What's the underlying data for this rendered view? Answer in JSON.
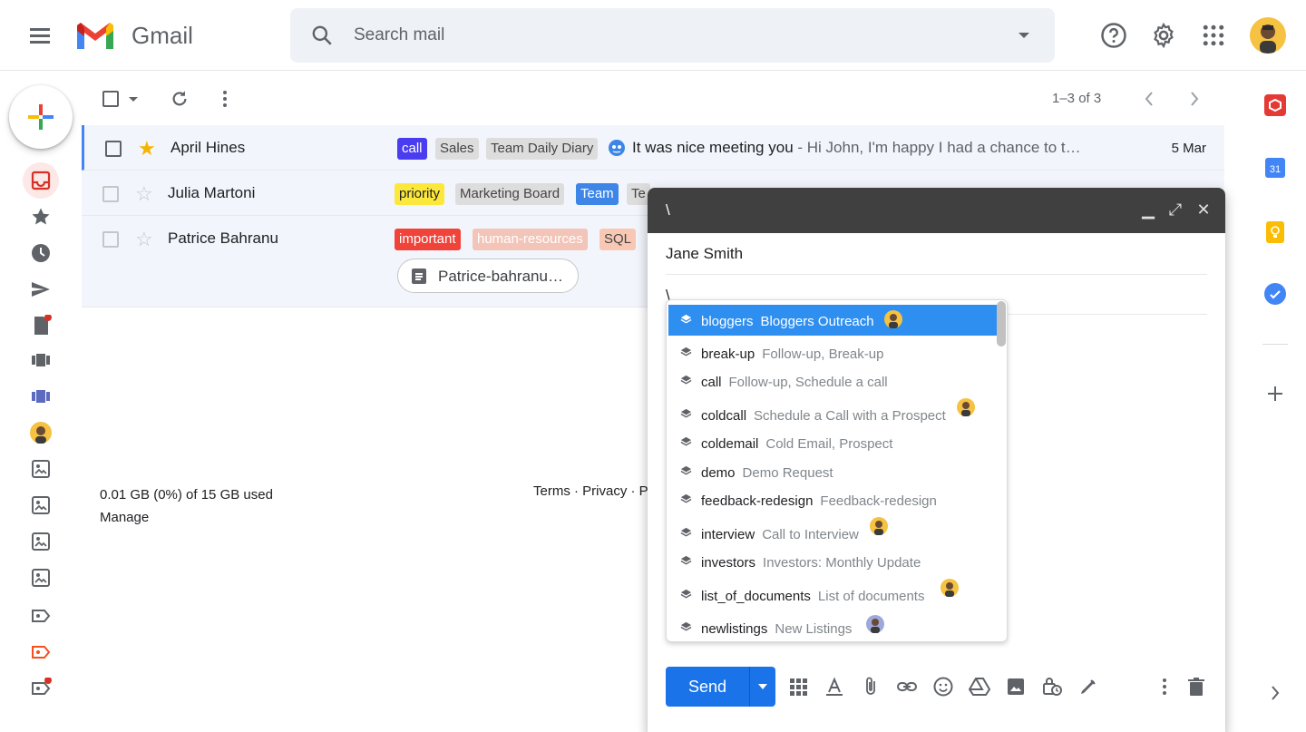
{
  "app": {
    "name": "Gmail"
  },
  "search": {
    "placeholder": "Search mail"
  },
  "toolbar": {
    "page_info": "1–3 of 3"
  },
  "emails": [
    {
      "sender": "April Hines",
      "starred": true,
      "labels": [
        {
          "text": "call",
          "bg": "#4a3df0",
          "fg": "#ffffff"
        },
        {
          "text": "Sales",
          "bg": "#dddddd",
          "fg": "#444444"
        },
        {
          "text": "Team Daily Diary",
          "bg": "#dddddd",
          "fg": "#444444"
        }
      ],
      "subject": "It was nice meeting you",
      "snippet": " - Hi John, I'm happy I had a chance to t…",
      "date": "5 Mar"
    },
    {
      "sender": "Julia Martoni",
      "starred": false,
      "labels": [
        {
          "text": "priority",
          "bg": "#fbe83b",
          "fg": "#202124"
        },
        {
          "text": "Marketing Board",
          "bg": "#dddddd",
          "fg": "#444444"
        },
        {
          "text": "Team",
          "bg": "#3d86e8",
          "fg": "#ffffff"
        },
        {
          "text": "Te",
          "bg": "#dddddd",
          "fg": "#444444"
        }
      ]
    },
    {
      "sender": "Patrice Bahranu",
      "starred": false,
      "labels": [
        {
          "text": "important",
          "bg": "#f0433a",
          "fg": "#ffffff"
        },
        {
          "text": "human-resources",
          "bg": "#f3c4b8",
          "fg": "#ffffff"
        },
        {
          "text": "SQL",
          "bg": "#f8c8b5",
          "fg": "#444444"
        }
      ],
      "attachment": "Patrice-bahranu…"
    }
  ],
  "storage": {
    "usage": "0.01 GB (0%) of 15 GB used",
    "manage": "Manage"
  },
  "footer": {
    "links": "Terms · Privacy · P"
  },
  "compose": {
    "title": "\\",
    "to": "Jane Smith",
    "subject": "\\",
    "send_label": "Send"
  },
  "snippets": [
    {
      "key": "bloggers",
      "desc": "Bloggers Outreach",
      "avatar": true,
      "active": true
    },
    {
      "key": "break-up",
      "desc": "Follow-up, Break-up",
      "avatar": false
    },
    {
      "key": "call",
      "desc": "Follow-up, Schedule a call",
      "avatar": false
    },
    {
      "key": "coldcall",
      "desc": "Schedule a Call with a Prospect",
      "avatar": true
    },
    {
      "key": "coldemail",
      "desc": "Cold Email, Prospect",
      "avatar": false
    },
    {
      "key": "demo",
      "desc": "Demo Request",
      "avatar": false
    },
    {
      "key": "feedback-redesign",
      "desc": "Feedback-redesign",
      "avatar": false
    },
    {
      "key": "interview",
      "desc": "Call to Interview",
      "avatar": true
    },
    {
      "key": "investors",
      "desc": "Investors: Monthly Update",
      "avatar": false
    },
    {
      "key": "list_of_documents",
      "desc": "List of documents",
      "avatar": true
    },
    {
      "key": "newlistings",
      "desc": "New Listings",
      "avatar": true
    }
  ],
  "colors": {
    "accent": "#1a73e8",
    "highlight": "#2f8ff0",
    "inbox_red": "#d93025"
  },
  "icons": [
    "menu-icon",
    "search-icon",
    "help-icon",
    "settings-icon",
    "apps-icon",
    "inbox-icon",
    "star-icon",
    "clock-icon",
    "send-icon",
    "draft-icon",
    "label-icon",
    "layer-icon"
  ]
}
